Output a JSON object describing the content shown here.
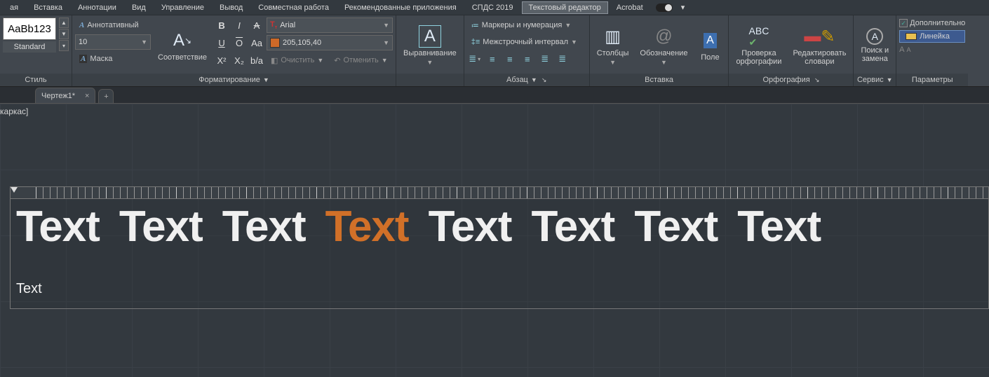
{
  "menu": {
    "items": [
      "ая",
      "Вставка",
      "Аннотации",
      "Вид",
      "Управление",
      "Вывод",
      "Совместная работа",
      "Рекомендованные приложения",
      "СПДС 2019",
      "Текстовый редактор",
      "Acrobat"
    ],
    "active_index": 9
  },
  "ribbon": {
    "style": {
      "sample": "AaBb123",
      "name": "Standard",
      "title": "Стиль"
    },
    "format": {
      "annotative": "Аннотативный",
      "size": "10",
      "mask": "Маска",
      "match": "Соответствие",
      "font": "Arial",
      "color": "205,105,40",
      "clear": "Очистить",
      "undo": "Отменить",
      "title": "Форматирование"
    },
    "align": {
      "label": "Выравнивание"
    },
    "paragraph": {
      "bullets": "Маркеры и нумерация",
      "spacing": "Межстрочный интервал",
      "title": "Абзац"
    },
    "insert": {
      "columns": "Столбцы",
      "symbol": "Обозначение",
      "field": "Поле",
      "title": "Вставка"
    },
    "spelling": {
      "check": "Проверка\nорфографии",
      "dict": "Редактировать\nсловари",
      "title": "Орфография"
    },
    "tools": {
      "findreplace": "Поиск и\nзамена",
      "title": "Сервис"
    },
    "options": {
      "extra": "Дополнительно",
      "ruler": "Линейка",
      "title": "Параметры"
    }
  },
  "tabs": {
    "doc": "Чертеж1*"
  },
  "canvas": {
    "corner": "каркас]",
    "words": [
      "Text",
      "Text",
      "Text",
      "Text",
      "Text",
      "Text",
      "Text",
      "Text"
    ],
    "orange_index": 3,
    "small": "Text"
  }
}
